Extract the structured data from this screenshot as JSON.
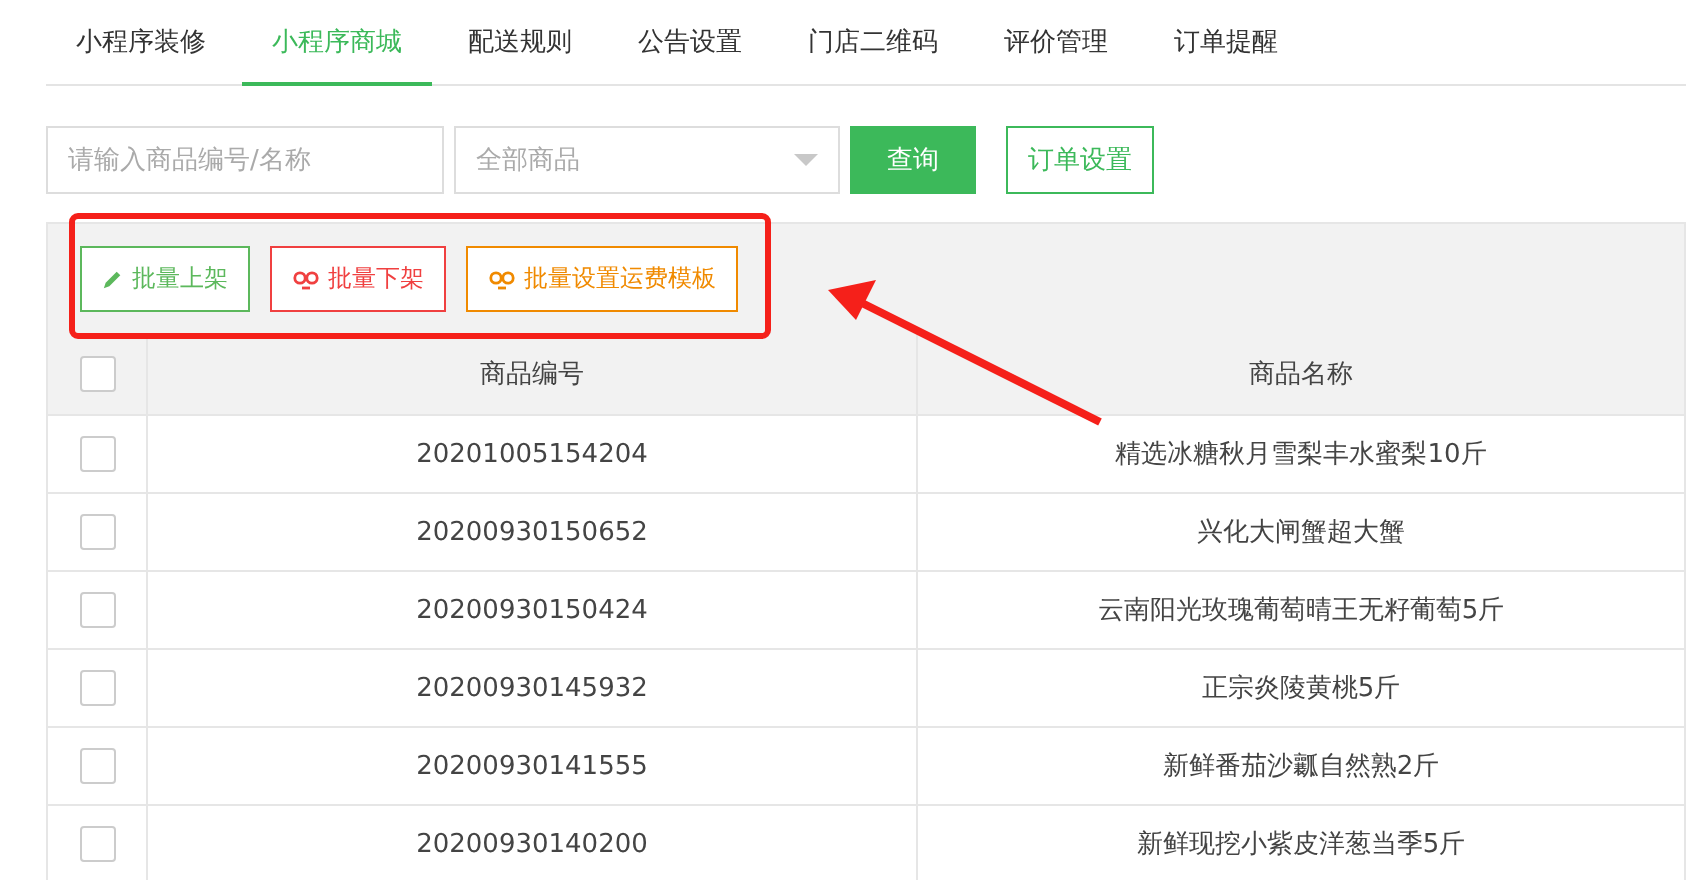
{
  "tabs": [
    {
      "label": "小程序装修",
      "selected": false
    },
    {
      "label": "小程序商城",
      "selected": true
    },
    {
      "label": "配送规则",
      "selected": false
    },
    {
      "label": "公告设置",
      "selected": false
    },
    {
      "label": "门店二维码",
      "selected": false
    },
    {
      "label": "评价管理",
      "selected": false
    },
    {
      "label": "订单提醒",
      "selected": false
    }
  ],
  "search": {
    "placeholder": "请输入商品编号/名称"
  },
  "filter": {
    "placeholder": "全部商品"
  },
  "query_button": "查询",
  "order_settings_button": "订单设置",
  "batch_buttons": [
    {
      "label": "批量上架",
      "kind": "edit",
      "color": "#5cb85c"
    },
    {
      "label": "批量下架",
      "kind": "link",
      "color": "#f04040"
    },
    {
      "label": "批量设置运费模板",
      "kind": "link",
      "color": "#f08a00"
    }
  ],
  "table": {
    "select_all_checked": false,
    "columns": [
      "商品编号",
      "商品名称"
    ],
    "rows": [
      {
        "checked": false,
        "cells": [
          "20201005154204",
          "精选冰糖秋月雪梨丰水蜜梨10斤"
        ]
      },
      {
        "checked": false,
        "cells": [
          "20200930150652",
          "兴化大闸蟹超大蟹"
        ]
      },
      {
        "checked": false,
        "cells": [
          "20200930150424",
          "云南阳光玫瑰葡萄晴王无籽葡萄5斤"
        ]
      },
      {
        "checked": false,
        "cells": [
          "20200930145932",
          "正宗炎陵黄桃5斤"
        ]
      },
      {
        "checked": false,
        "cells": [
          "20200930141555",
          "新鲜番茄沙瓤自然熟2斤"
        ]
      },
      {
        "checked": false,
        "cells": [
          "20200930140200",
          "新鲜现挖小紫皮洋葱当季5斤"
        ]
      }
    ]
  }
}
